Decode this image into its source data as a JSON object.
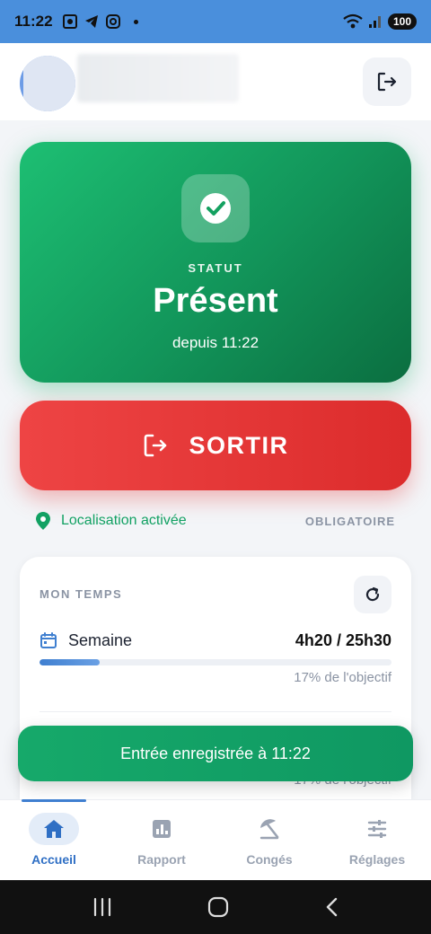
{
  "status_bar": {
    "time": "11:22",
    "battery": "100",
    "icons": [
      "screenshot-icon",
      "telegram-icon",
      "instagram-icon",
      "dot-icon",
      "wifi-icon",
      "signal-icon"
    ]
  },
  "header": {
    "logout_icon": "logout-icon"
  },
  "status_card": {
    "label": "STATUT",
    "value": "Présent",
    "since": "depuis 11:22",
    "icon": "check-icon"
  },
  "action": {
    "label": "SORTIR",
    "icon": "exit-icon",
    "color": "#e53935"
  },
  "location": {
    "text": "Localisation activée",
    "requirement": "OBLIGATOIRE",
    "icon": "location-pin-icon"
  },
  "time_card": {
    "title": "MON TEMPS",
    "week_label": "Semaine",
    "week_value": "4h20 / 25h30",
    "week_progress_percent": 17,
    "week_progress_text": "17% de l'objectif",
    "second_progress_text": "17% de l'objectif"
  },
  "toast": {
    "text": "Entrée enregistrée à 11:22"
  },
  "nav": {
    "items": [
      {
        "label": "Accueil",
        "icon": "home-icon",
        "active": true
      },
      {
        "label": "Rapport",
        "icon": "chart-icon",
        "active": false
      },
      {
        "label": "Congés",
        "icon": "beach-umbrella-icon",
        "active": false
      },
      {
        "label": "Réglages",
        "icon": "sliders-icon",
        "active": false
      }
    ]
  },
  "colors": {
    "accent": "#2f6fc4",
    "success": "#12955a",
    "danger": "#e53935"
  }
}
